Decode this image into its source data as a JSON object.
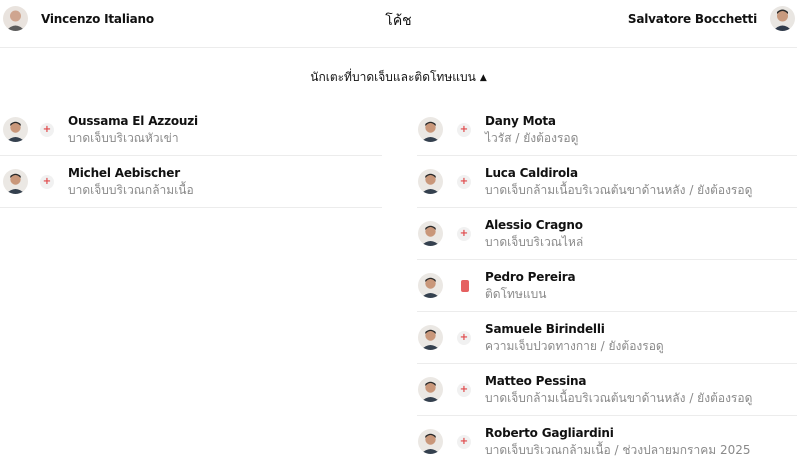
{
  "coaches": {
    "title": "โค้ช",
    "home": {
      "name": "Vincenzo Italiano"
    },
    "away": {
      "name": "Salvatore Bocchetti"
    }
  },
  "section": {
    "title": "นักเตะที่บาดเจ็บและติดโทษแบน",
    "caret": "▲"
  },
  "icons": {
    "injury": "injury-cross-icon",
    "suspension": "red-card-icon"
  },
  "colors": {
    "injury_cross": "#e0484a",
    "red_card": "#e56060",
    "detail_text": "#8a8a8a"
  },
  "home_players": [
    {
      "name": "Oussama El Azzouzi",
      "detail": "บาดเจ็บบริเวณหัวเข่า",
      "status": "injury"
    },
    {
      "name": "Michel Aebischer",
      "detail": "บาดเจ็บบริเวณกล้ามเนื้อ",
      "status": "injury"
    }
  ],
  "away_players": [
    {
      "name": "Dany Mota",
      "detail": "ไวรัส / ยังต้องรอดู",
      "status": "injury"
    },
    {
      "name": "Luca Caldirola",
      "detail": "บาดเจ็บกล้ามเนื้อบริเวณต้นขาด้านหลัง / ยังต้องรอดู",
      "status": "injury"
    },
    {
      "name": "Alessio Cragno",
      "detail": "บาดเจ็บบริเวณไหล่",
      "status": "injury"
    },
    {
      "name": "Pedro Pereira",
      "detail": "ติดโทษแบน",
      "status": "suspension"
    },
    {
      "name": "Samuele Birindelli",
      "detail": "ความเจ็บปวดทางกาย / ยังต้องรอดู",
      "status": "injury"
    },
    {
      "name": "Matteo Pessina",
      "detail": "บาดเจ็บกล้ามเนื้อบริเวณต้นขาด้านหลัง / ยังต้องรอดู",
      "status": "injury"
    },
    {
      "name": "Roberto Gagliardini",
      "detail": "บาดเจ็บบริเวณกล้ามเนื้อ / ช่วงปลายมกราคม 2025",
      "status": "injury"
    }
  ]
}
